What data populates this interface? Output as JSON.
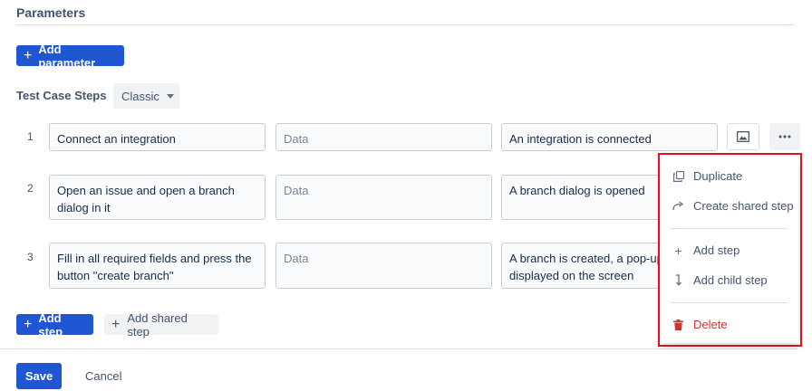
{
  "parameters": {
    "title": "Parameters",
    "add_label": "Add parameter"
  },
  "steps": {
    "title": "Test Case Steps",
    "view_select": "Classic",
    "rows": [
      {
        "num": "1",
        "action": "Connect an integration",
        "data": "Data",
        "result": "An integration is connected"
      },
      {
        "num": "2",
        "action": "Open an issue and open a branch dialog  in it",
        "data": "Data",
        "result": "A branch dialog is opened"
      },
      {
        "num": "3",
        "action": "Fill in all required fields and press the button \"create branch\"",
        "data": "Data",
        "result": "A branch is created, a pop-up displayed on the screen"
      }
    ],
    "add_step_label": "Add step",
    "add_shared_label": "Add shared step"
  },
  "menu": {
    "duplicate": "Duplicate",
    "create_shared": "Create shared step",
    "add_step": "Add step",
    "add_child": "Add child step",
    "delete": "Delete"
  },
  "footer": {
    "save": "Save",
    "cancel": "Cancel"
  },
  "colors": {
    "primary": "#1f56d1",
    "danger": "#c9372c",
    "highlight": "#e0141e"
  }
}
